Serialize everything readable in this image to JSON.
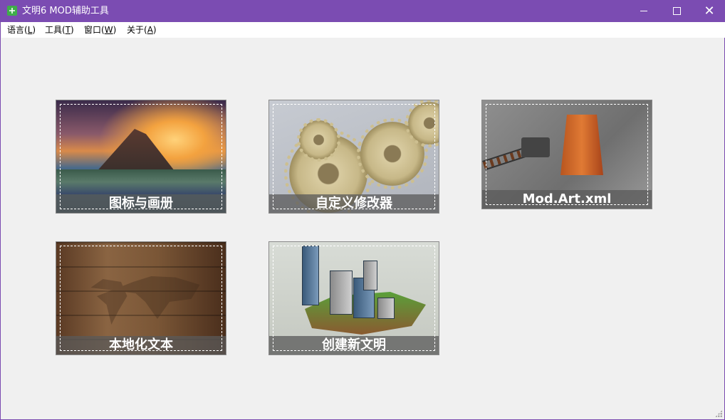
{
  "window": {
    "title": "文明6 MOD辅助工具",
    "accent_color": "#7b4cb2",
    "icon": "app-plus-icon"
  },
  "controls": {
    "minimize": "minimize-icon",
    "maximize": "maximize-icon",
    "close": "close-icon",
    "close_glyph": "✕"
  },
  "menu": {
    "items": [
      {
        "label": "语言(",
        "key": "L",
        "tail": ")"
      },
      {
        "label": "工具(",
        "key": "T",
        "tail": ")"
      },
      {
        "label": "窗口(",
        "key": "W",
        "tail": ")"
      },
      {
        "label": "关于(",
        "key": "A",
        "tail": ")"
      }
    ]
  },
  "tiles": [
    {
      "caption": "图标与画册"
    },
    {
      "caption": "自定义修改器"
    },
    {
      "caption": "Mod.Art.xml"
    },
    {
      "caption": "本地化文本"
    },
    {
      "caption": "创建新文明"
    }
  ]
}
